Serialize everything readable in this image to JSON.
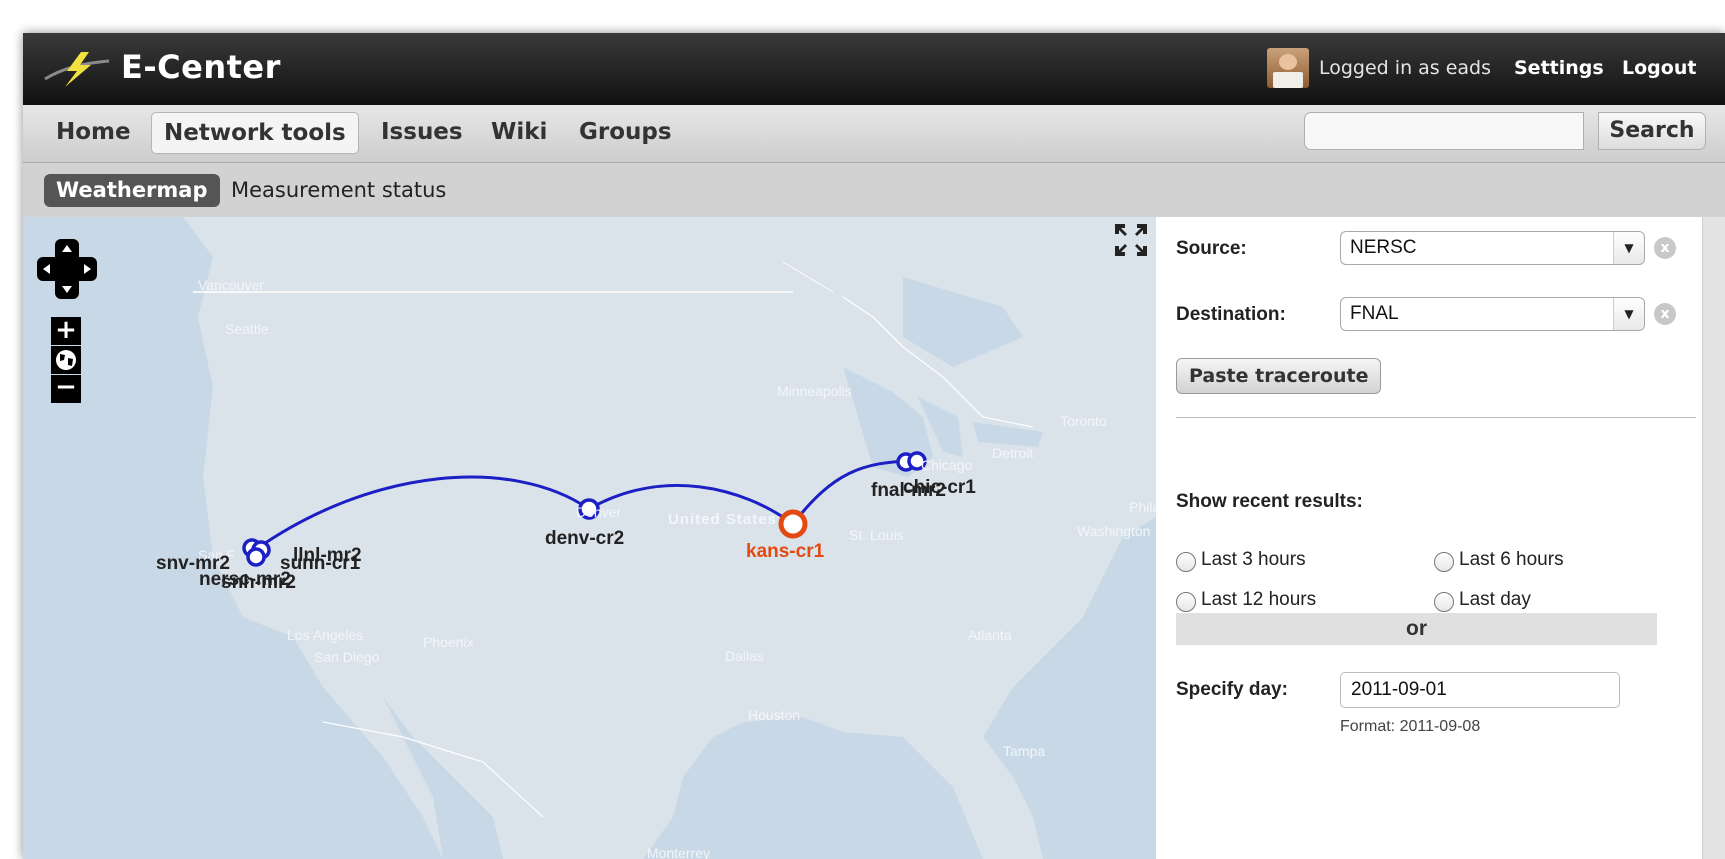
{
  "header": {
    "app_title": "E-Center",
    "logged_in_text": "Logged in as eads",
    "settings_label": "Settings",
    "logout_label": "Logout"
  },
  "nav": {
    "items": [
      {
        "label": "Home",
        "active": false
      },
      {
        "label": "Network tools",
        "active": true
      },
      {
        "label": "Issues",
        "active": false
      },
      {
        "label": "Wiki",
        "active": false
      },
      {
        "label": "Groups",
        "active": false
      }
    ],
    "search_value": "",
    "search_button": "Search"
  },
  "subnav": {
    "items": [
      {
        "label": "Weathermap",
        "active": true
      },
      {
        "label": "Measurement status",
        "active": false
      }
    ]
  },
  "map": {
    "cities": [
      "Vancouver",
      "Seattle",
      "Minneapolis",
      "Toronto",
      "Detroit",
      "Chicago",
      "Philadelphia",
      "Washington",
      "St. Louis",
      "Denver",
      "San Francisco",
      "Los Angeles",
      "San Diego",
      "Phoenix",
      "Dallas",
      "Atlanta",
      "Houston",
      "Tampa",
      "Monterrey"
    ],
    "country_label": "United States",
    "nodes": [
      "snv-mr2",
      "llnl-mr2",
      "sunn-cr1",
      "nersc-mr2",
      "snh-mr2",
      "denv-cr2",
      "kans-cr1",
      "fnal-mr2",
      "chic-cr1"
    ],
    "highlighted_node": "kans-cr1",
    "colors": {
      "water": "#c9d8e6",
      "land": "#dbe3ea",
      "link": "#1b1fc4",
      "highlight": "#e24a12"
    }
  },
  "panel": {
    "source_label": "Source:",
    "source_value": "NERSC",
    "destination_label": "Destination:",
    "destination_value": "FNAL",
    "clear_glyph": "x",
    "paste_button": "Paste traceroute",
    "recent_label": "Show recent results:",
    "recent_options": [
      "Last 3 hours",
      "Last 6 hours",
      "Last 12 hours",
      "Last day"
    ],
    "or_text": "or",
    "day_label": "Specify day:",
    "day_value": "2011-09-01",
    "format_hint": "Format: 2011-09-08"
  }
}
